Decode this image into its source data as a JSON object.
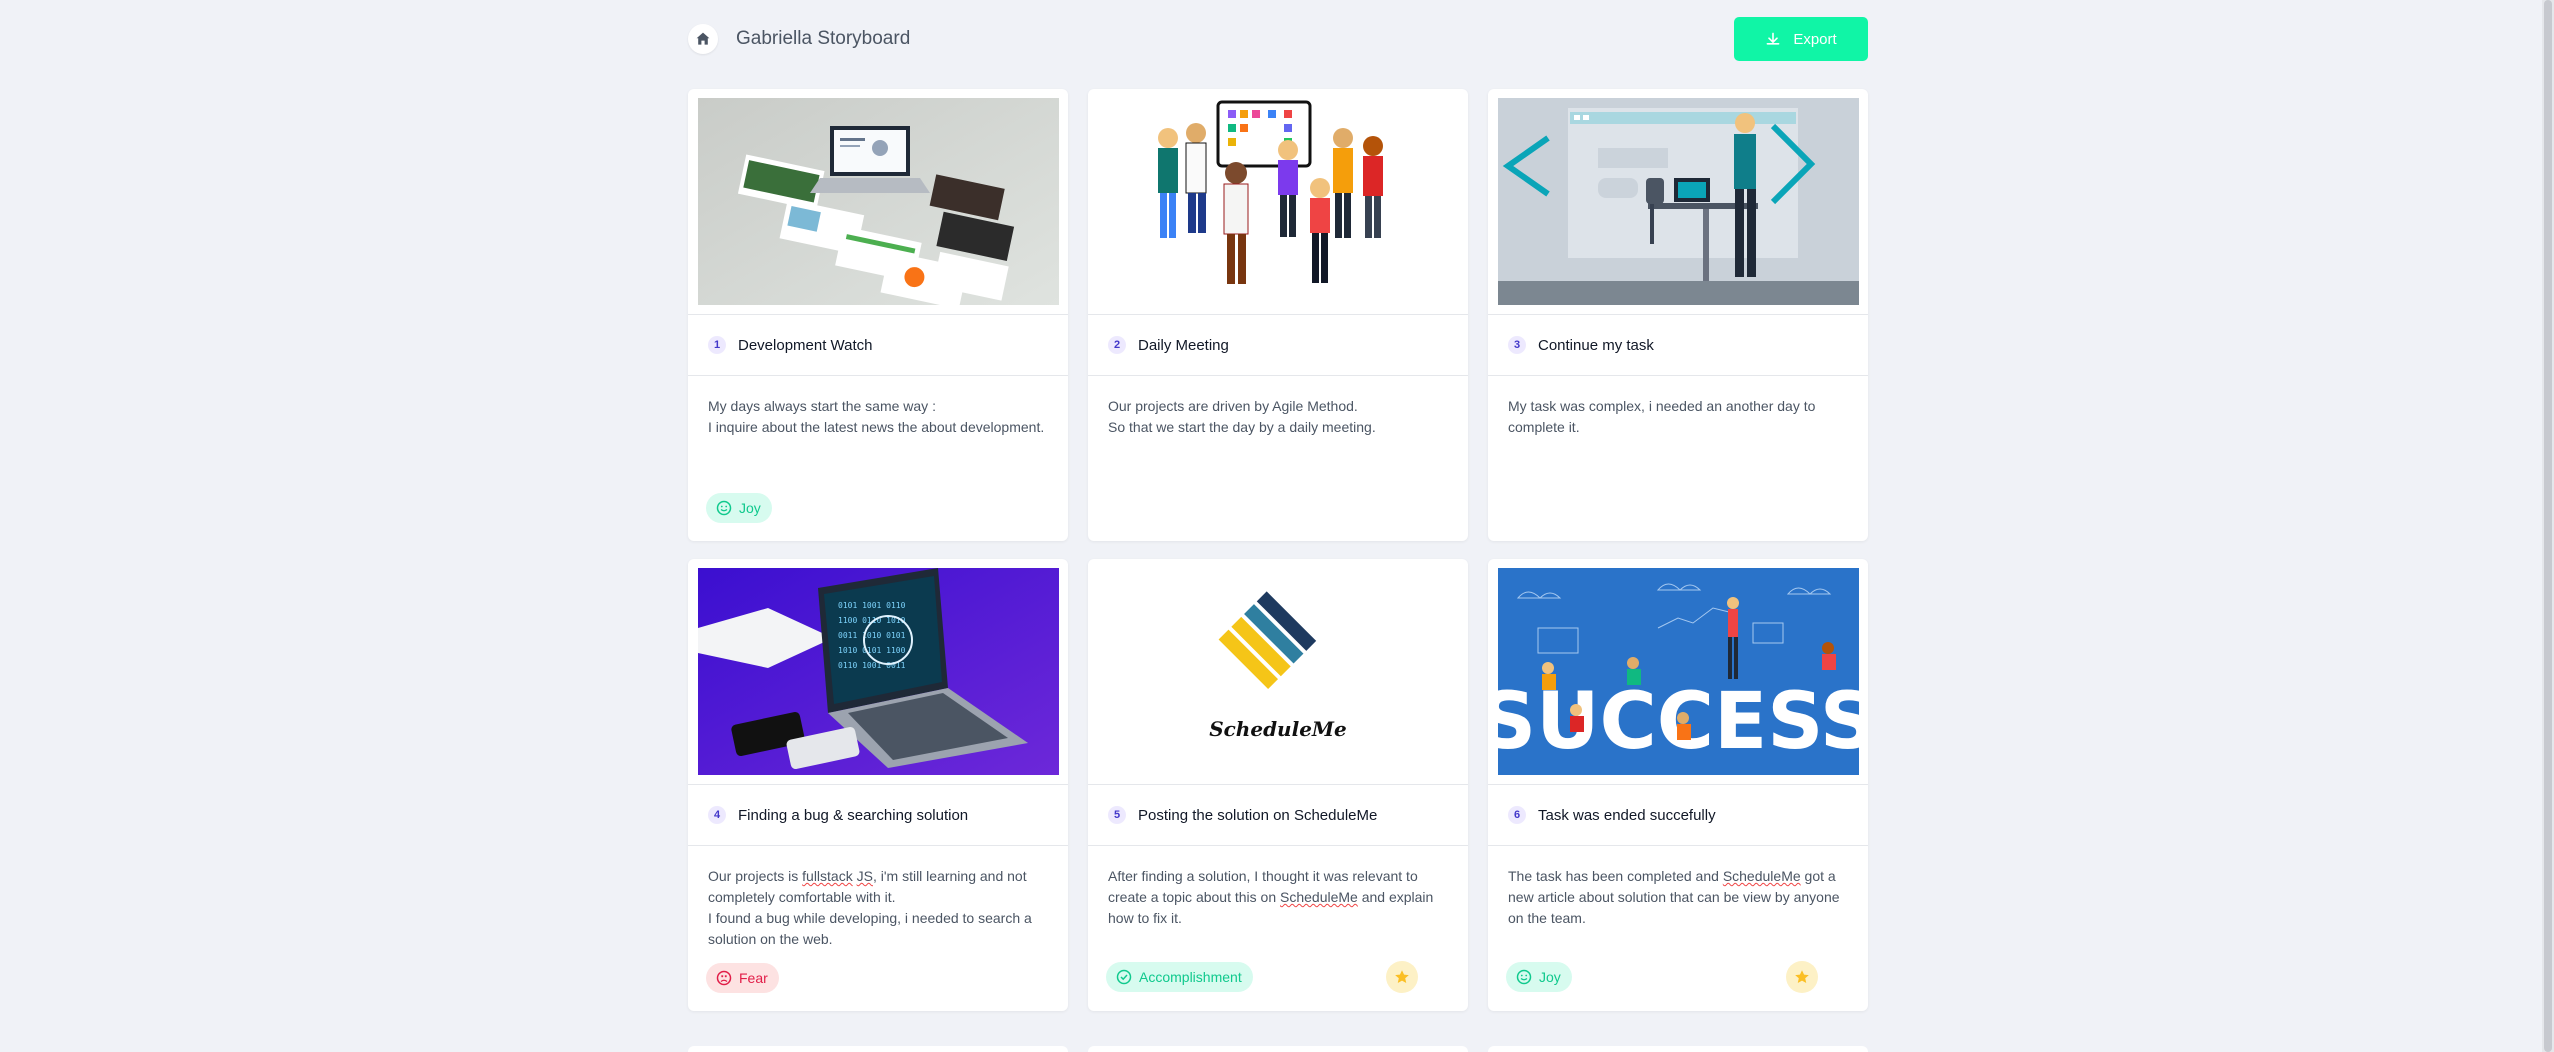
{
  "header": {
    "title": "Gabriella Storyboard",
    "export_label": "Export"
  },
  "colors": {
    "accent": "#10f5a6",
    "joy": "#10c98d",
    "fear": "#e11d48",
    "star": "#fbbf24"
  },
  "cards": [
    {
      "number": "1",
      "title": "Development Watch",
      "description": "My days always start the same way :\nI inquire about the latest news the about development.",
      "emotion": "Joy",
      "emotion_icon": "smile-icon",
      "starred": false
    },
    {
      "number": "2",
      "title": "Daily Meeting",
      "description": "Our projects are driven by Agile Method.\nSo that we start the day by a daily meeting.",
      "emotion": "",
      "starred": false
    },
    {
      "number": "3",
      "title": "Continue my task",
      "description": "My task was complex, i needed an another day to complete it.",
      "emotion": "",
      "starred": false
    },
    {
      "number": "4",
      "title": "Finding a bug & searching solution",
      "description_parts": [
        "Our projects is ",
        "fullstack",
        " ",
        "JS",
        ", i'm still learning and not completely comfortable with it.\nI found a bug while developing, i needed to search a solution on the web."
      ],
      "emotion": "Fear",
      "emotion_icon": "frown-icon",
      "starred": false
    },
    {
      "number": "5",
      "title": "Posting the solution on ScheduleMe",
      "description_parts": [
        "After finding a solution, I thought it was relevant to create a topic about this on ",
        "ScheduleMe",
        " and explain how to fix it."
      ],
      "emotion": "Accomplishment",
      "emotion_icon": "check-circle-icon",
      "starred": true
    },
    {
      "number": "6",
      "title": "Task was ended succefully",
      "description_parts": [
        "The task has been completed and ",
        "ScheduleMe",
        " got a new article about solution that can be view by anyone on the team."
      ],
      "emotion": "Joy",
      "emotion_icon": "smile-icon",
      "starred": true
    }
  ],
  "images": {
    "logo_text": "ScheduleMe",
    "success_text": "SUCCESS"
  }
}
